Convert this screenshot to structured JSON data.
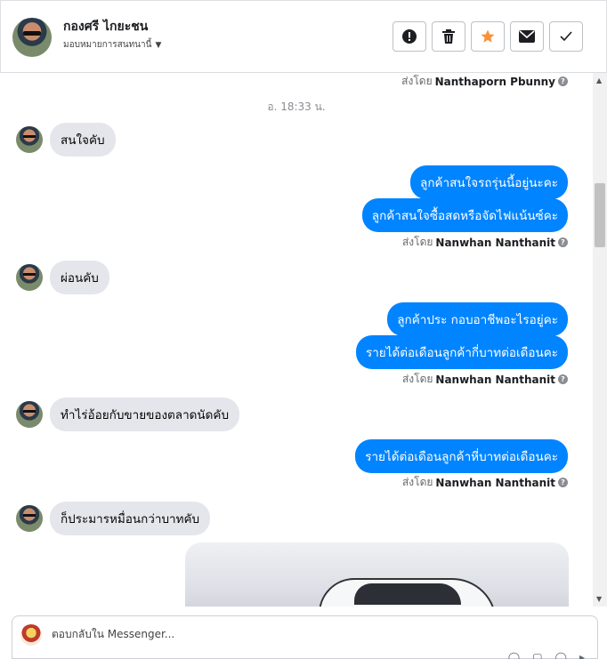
{
  "header": {
    "contact_name": "กองศรี ไกยะชน",
    "assign_label": "มอบหมายการสนทนานี้",
    "actions": [
      {
        "name": "mark-spam-button",
        "icon": "exclamation-icon"
      },
      {
        "name": "delete-button",
        "icon": "trash-icon"
      },
      {
        "name": "star-button",
        "icon": "star-icon"
      },
      {
        "name": "mark-unread-button",
        "icon": "envelope-icon"
      },
      {
        "name": "mark-done-button",
        "icon": "check-icon"
      }
    ],
    "star_color": "#f7923b"
  },
  "thread": {
    "sent_by_prefix": "ส่งโดย",
    "top_sender": "Nanthaporn Pbunny",
    "timestamp": "อ. 18:33 น.",
    "messages": [
      {
        "dir": "in",
        "text": "สนใจคับ"
      },
      {
        "dir": "out",
        "text": "ลูกค้าสนใจรถรุ่นนี้อยู่นะคะ"
      },
      {
        "dir": "out",
        "text": "ลูกค้าสนใจซื้อสดหรือจัดไฟแน้นซ์คะ"
      },
      {
        "dir": "sent_by",
        "name": "Nanwhan Nanthanit"
      },
      {
        "dir": "in",
        "text": "ผ่อนคับ"
      },
      {
        "dir": "out",
        "text": "ลูกค้าประ กอบอาชีพอะไรอยู่คะ"
      },
      {
        "dir": "out",
        "text": "รายได้ต่อเดือนลูกค้ากี่บาทต่อเดือนคะ"
      },
      {
        "dir": "sent_by",
        "name": "Nanwhan Nanthanit"
      },
      {
        "dir": "in",
        "text": "ทำไร่อ้อยกับขายของตลาดนัดคับ"
      },
      {
        "dir": "out",
        "text": "รายได้ต่อเดือนลูกค้าหี่บาทต่อเดือนคะ"
      },
      {
        "dir": "sent_by",
        "name": "Nanwhan Nanthanit"
      },
      {
        "dir": "in",
        "text": "ก็ประมารหมื่อนกว่าบาทคับ"
      }
    ],
    "bubble_out_color": "#0084ff",
    "bubble_in_color": "#e4e6eb"
  },
  "composer": {
    "placeholder": "ตอบกลับใน Messenger..."
  }
}
